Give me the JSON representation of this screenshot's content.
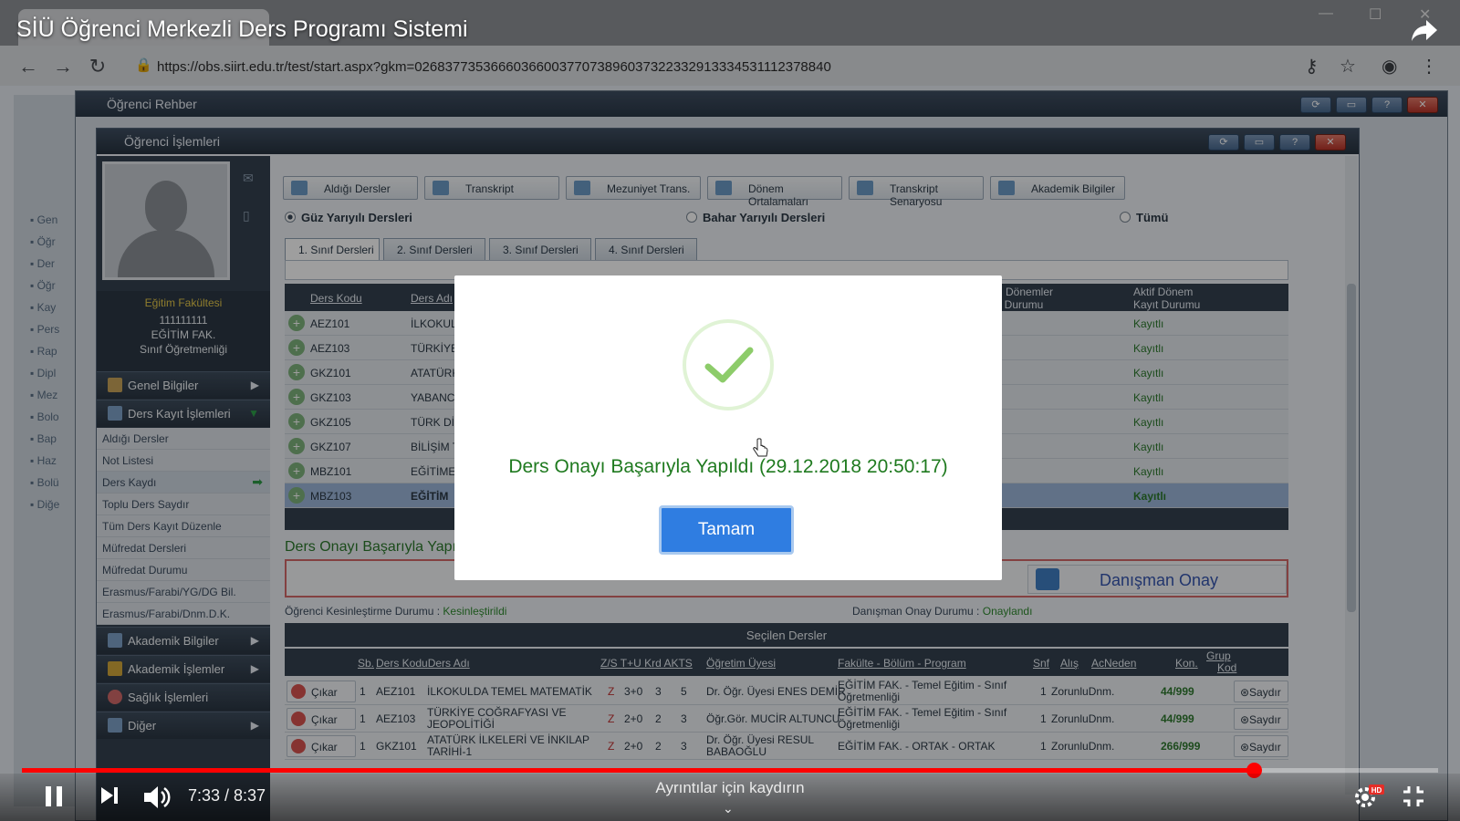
{
  "video": {
    "title": "SİÜ Öğrenci Merkezli Ders Programı Sistemi",
    "time_display": "7:33 / 8:37",
    "progress_fraction": 0.87,
    "details_hint": "Ayrıntılar için kaydırın",
    "hd_badge": "HD"
  },
  "browser": {
    "url": "https://obs.siirt.edu.tr/test/start.aspx?gkm=0268377353666036600377073896037322332913334531112378840"
  },
  "side_strip": [
    "Gen",
    "Öğr",
    "Der",
    "Öğr",
    "Kay",
    "Pers",
    "Rap",
    "Dipl",
    "Mez",
    "Bolo",
    "Bap",
    "Haz",
    "Bolü",
    "Diğe"
  ],
  "rehber": {
    "title": "Öğrenci Rehber"
  },
  "islem": {
    "title": "Öğrenci İşlemleri"
  },
  "profile": {
    "faculty": "Eğitim Fakültesi",
    "student_no": "111111111",
    "unit": "EĞİTİM FAK.",
    "program": "Sınıf Öğretmenliği"
  },
  "menu": {
    "genel": "Genel Bilgiler",
    "ders_kayit": "Ders Kayıt İşlemleri",
    "sub": [
      "Aldığı Dersler",
      "Not Listesi",
      "Ders Kaydı",
      "Toplu Ders Saydır",
      "Tüm Ders Kayıt Düzenle",
      "Müfredat Dersleri",
      "Müfredat Durumu",
      "Erasmus/Farabi/YG/DG Bil.",
      "Erasmus/Farabi/Dnm.D.K."
    ],
    "akademik_bilgiler": "Akademik Bilgiler",
    "akademik_islemler": "Akademik İşlemler",
    "saglik": "Sağlık İşlemleri",
    "diger": "Diğer"
  },
  "toolbar": [
    "Aldığı Dersler",
    "Transkript",
    "Mezuniyet Trans.",
    "Dönem Ortalamaları",
    "Transkript Senaryosu",
    "Akademik Bilgiler"
  ],
  "semester_radios": {
    "guz": "Güz Yarıyılı Dersleri",
    "bahar": "Bahar Yarıyılı Dersleri",
    "tumu": "Tümü"
  },
  "class_tabs": [
    "1. Sınıf Dersleri",
    "2. Sınıf Dersleri",
    "3. Sınıf Dersleri",
    "4. Sınıf Dersleri"
  ],
  "course_grid": {
    "headers": {
      "code": "Ders Kodu",
      "name": "Ders Adı",
      "prev_status_1": "ki Dönemler",
      "prev_status_2": "ır Durumu",
      "active_1": "Aktif Dönem",
      "active_2": "Kayıt Durumu"
    },
    "rows": [
      {
        "code": "AEZ101",
        "name": "İLKOKULU",
        "status": "Kayıtlı"
      },
      {
        "code": "AEZ103",
        "name": "TÜRKİYE",
        "status": "Kayıtlı"
      },
      {
        "code": "GKZ101",
        "name": "ATATÜRK",
        "status": "Kayıtlı"
      },
      {
        "code": "GKZ103",
        "name": "YABANCI",
        "status": "Kayıtlı"
      },
      {
        "code": "GKZ105",
        "name": "TÜRK DİL",
        "status": "Kayıtlı"
      },
      {
        "code": "GKZ107",
        "name": "BİLİŞİM T",
        "status": "Kayıtlı"
      },
      {
        "code": "MBZ101",
        "name": "EĞİTİME",
        "status": "Kayıtlı"
      },
      {
        "code": "MBZ103",
        "name": "EĞİTİM",
        "status": "Kayıtlı"
      }
    ]
  },
  "status": {
    "success_partial": "Ders Onayı Başarıyla Yapı",
    "danisman_onay": "Danışman Onay",
    "kesinlestirme_label": "Öğrenci Kesinleştirme Durumu :",
    "kesinlestirme_value": "Kesinleştirildi",
    "danisman_label": "Danışman Onay Durumu :",
    "danisman_value": "Onaylandı"
  },
  "selected": {
    "title": "Seçilen Dersler",
    "headers": {
      "sb": "Sb.",
      "kod_ad": "Ders KoduDers Adı",
      "zs": "Z/S T+U Krd AKTS",
      "ogr": "Öğretim Üyesi",
      "fak": "Fakülte - Bölüm - Program",
      "snf": "Snf",
      "alis": "Alış",
      "acneden": "AcNeden",
      "kon": "Kon.",
      "grup_1": "Grup",
      "grup_2": "Kod"
    },
    "rows": [
      {
        "action": "Çıkar",
        "sb": "1",
        "code": "AEZ101",
        "name": "İLKOKULDA TEMEL MATEMATİK",
        "zs": "Z",
        "tu": "3+0",
        "krd": "3",
        "akts": "5",
        "instructor": "Dr. Öğr. Üyesi ENES DEMİR",
        "fac_1": "EĞİTİM FAK. - Temel Eğitim - Sınıf",
        "fac_2": "Öğretmenliği",
        "snf": "1",
        "alis": "ZorunluDnm.",
        "kon": "44/999",
        "btn": "Saydır"
      },
      {
        "action": "Çıkar",
        "sb": "1",
        "code": "AEZ103",
        "name": "TÜRKİYE COĞRAFYASI VE",
        "name_2": "JEOPOLİTİĞİ",
        "zs": "Z",
        "tu": "2+0",
        "krd": "2",
        "akts": "3",
        "instructor": "Öğr.Gör. MUCİR ALTUNCU",
        "fac_1": "EĞİTİM FAK. - Temel Eğitim - Sınıf",
        "fac_2": "Öğretmenliği",
        "snf": "1",
        "alis": "ZorunluDnm.",
        "kon": "44/999",
        "btn": "Saydır"
      },
      {
        "action": "Çıkar",
        "sb": "1",
        "code": "GKZ101",
        "name": "ATATÜRK İLKELERİ VE İNKILAP",
        "name_2": "TARİHİ-1",
        "zs": "Z",
        "tu": "2+0",
        "krd": "2",
        "akts": "3",
        "instructor": "Dr. Öğr. Üyesi RESUL",
        "instructor_2": "BABAOĞLU",
        "fac_1": "EĞİTİM FAK. - ORTAK - ORTAK",
        "snf": "1",
        "alis": "ZorunluDnm.",
        "kon": "266/999",
        "btn": "Saydır"
      }
    ]
  },
  "modal": {
    "message": "Ders Onayı Başarıyla Yapıldı (29.12.2018 20:50:17)",
    "ok_label": "Tamam"
  }
}
